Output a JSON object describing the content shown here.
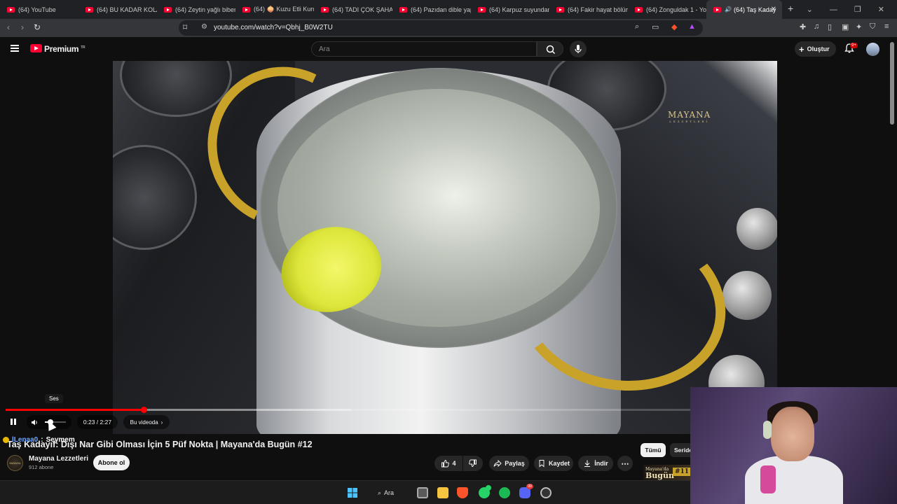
{
  "browser": {
    "tabs": [
      {
        "label": "(64) YouTube"
      },
      {
        "label": "(64) BU KADAR KOLAY"
      },
      {
        "label": "(64) Zeytin yağlı biber"
      },
      {
        "label": "(64) 🧅 Kuzu Etli Kuru"
      },
      {
        "label": "(64) TADI ÇOK ŞAHAN"
      },
      {
        "label": "(64) Pazıdan dible yap"
      },
      {
        "label": "(64) Karpuz suyundan"
      },
      {
        "label": "(64) Fakir hayat bölüm"
      },
      {
        "label": "(64) Zonguldak 1 - Yo"
      },
      {
        "label": "(64) Taş Kaday"
      }
    ],
    "url": "youtube.com/watch?v=Qbhj_B0W2TU"
  },
  "header": {
    "logo_text": "Premium",
    "logo_region": "TR",
    "search_placeholder": "Ara",
    "create_label": "Oluştur",
    "notifications": "9+"
  },
  "video": {
    "watermark": "MAYANA",
    "watermark_sub": "LEZZETLERİ",
    "tooltip": "Ses",
    "progress": 0.156,
    "buffered": 0.39,
    "volume": 0.25,
    "time": "0:23 / 2:27",
    "chapter_label": "Bu videoda"
  },
  "chat_overlay": {
    "user": "lLenaa0",
    "message": "Seymem"
  },
  "details": {
    "title": "Taş Kadayıf: Dışı Nar Gibi Olması İçin 5 Püf Nokta | Mayana'da Bugün #12",
    "channel_name": "Mayana Lezzetleri",
    "channel_avatar_text": "MAYANA",
    "subscribers": "912 abone",
    "subscribe_label": "Abone ol",
    "likes": "4",
    "share_label": "Paylaş",
    "save_label": "Kaydet",
    "download_label": "İndir"
  },
  "related": {
    "chip_all": "Tümü",
    "chip_series": "Seride",
    "thumb_line1": "Mayana'da",
    "thumb_line2": "Bugün",
    "thumb_number": "#11"
  },
  "taskbar": {
    "search_label": "Ara",
    "discord_badge": "99"
  },
  "colors": {
    "accent": "#ff0033",
    "progress": "#ff0000",
    "background": "#0f0f0f"
  }
}
